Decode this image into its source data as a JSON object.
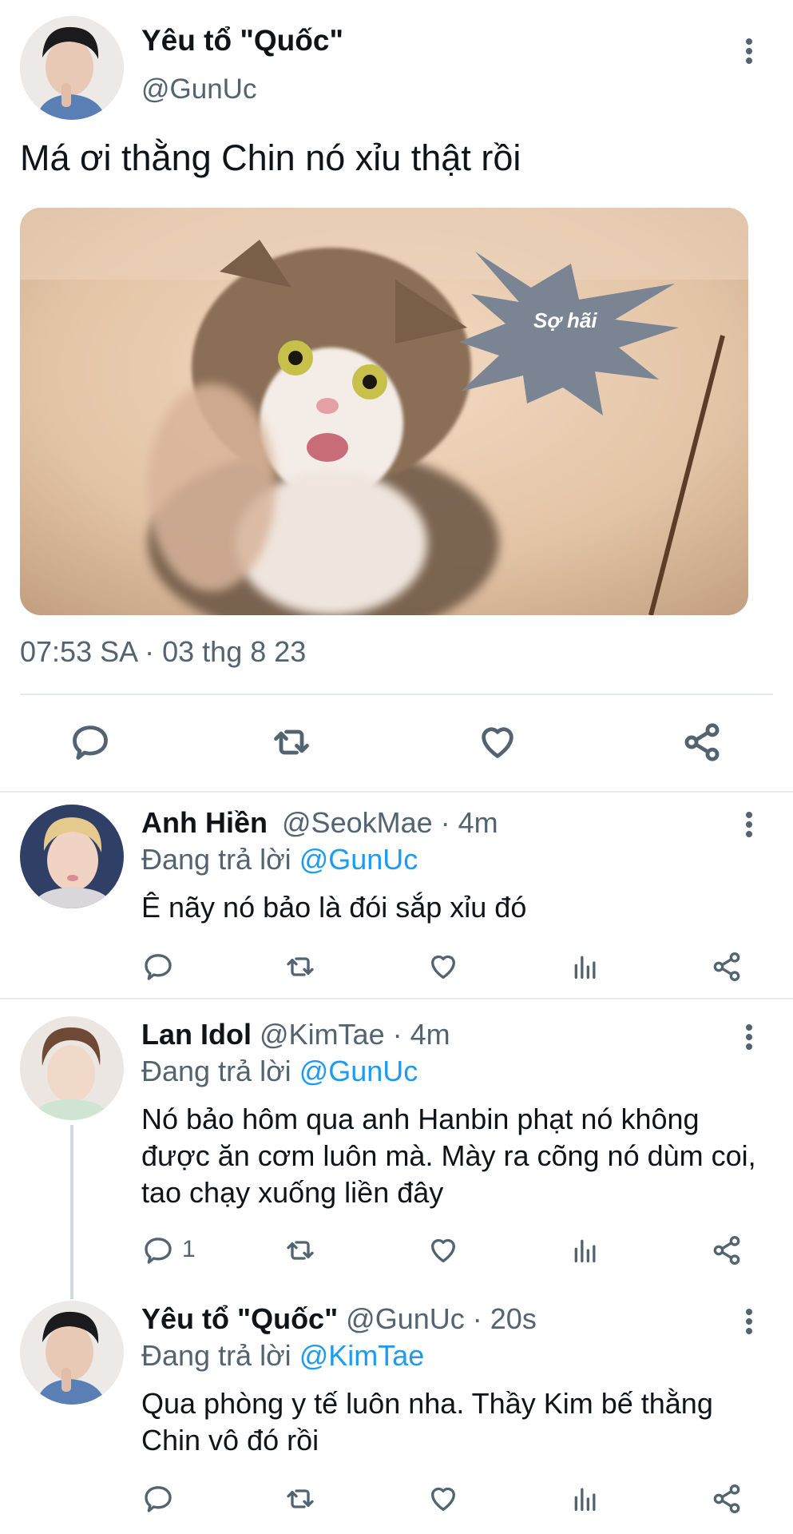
{
  "main_tweet": {
    "author_name": "Yêu tổ \"Quốc\"",
    "handle": "@GunUc",
    "text": "Má ơi thằng Chin nó xỉu thật rồi",
    "image_caption": "Sợ hãi",
    "timestamp": "07:53 SA · 03 thg 8 23",
    "actions": [
      "reply-icon",
      "retweet-icon",
      "like-icon",
      "share-icon"
    ]
  },
  "replies": [
    {
      "author_name": "Anh Hiền",
      "handle": "@SeokMae",
      "time": "· 4m",
      "replying_prefix": "Đang trả lời",
      "replying_to": "@GunUc",
      "text": "Ê nãy nó bảo là đói sắp xỉu đó",
      "reply_count": ""
    },
    {
      "author_name": "Lan Idol",
      "handle": "@KimTae",
      "time": "· 4m",
      "replying_prefix": "Đang trả lời",
      "replying_to": "@GunUc",
      "text": "Nó bảo hôm qua anh Hanbin phạt nó không được ăn cơm luôn mà. Mày ra cõng nó dùm coi, tao chạy xuống liền đây",
      "reply_count": "1"
    },
    {
      "author_name": "Yêu tổ \"Quốc\"",
      "handle": "@GunUc",
      "time": "· 20s",
      "replying_prefix": "Đang trả lời",
      "replying_to": "@KimTae",
      "text": "Qua phòng y tế luôn nha. Thầy Kim bế thằng Chin vô đó rồi",
      "reply_count": ""
    }
  ],
  "colors": {
    "link": "#1d9bf0",
    "muted": "#536471",
    "bubble": "#7a8493"
  }
}
